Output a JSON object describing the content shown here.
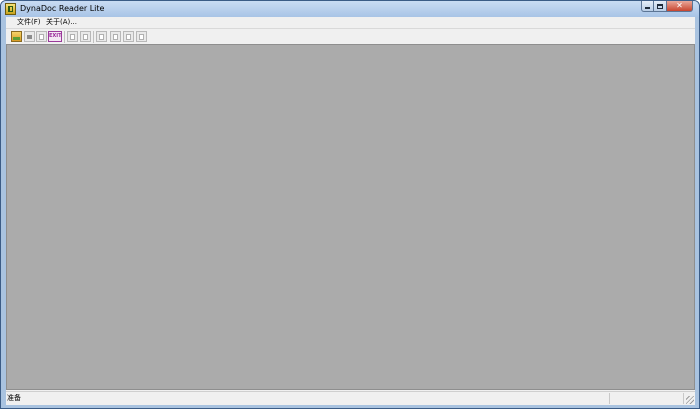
{
  "window": {
    "title": "DynaDoc Reader Lite",
    "controls": {
      "minimize": "minimize",
      "maximize": "maximize",
      "close": "✕"
    }
  },
  "menubar": {
    "items": [
      "文件(F)",
      "关于(A)..."
    ]
  },
  "toolbar": {
    "buttons": [
      {
        "icon": "open-folder-icon"
      },
      {
        "icon": "print-icon"
      },
      {
        "icon": "blank-page-icon"
      },
      {
        "icon": "exit-icon",
        "label": "EXIT"
      },
      {
        "icon": "page-split-icon"
      },
      {
        "icon": "page-icon"
      },
      {
        "icon": "page-first-icon"
      },
      {
        "icon": "page-prev-icon"
      },
      {
        "icon": "page-next-icon"
      },
      {
        "icon": "page-last-icon"
      }
    ]
  },
  "statusbar": {
    "text": "准备"
  },
  "colors": {
    "titlebar": "#a8c4e6",
    "workspace": "#ababab",
    "client_bg": "#f0f0f0",
    "close_button": "#c8452f",
    "exit_icon": "#9a2a9a"
  }
}
